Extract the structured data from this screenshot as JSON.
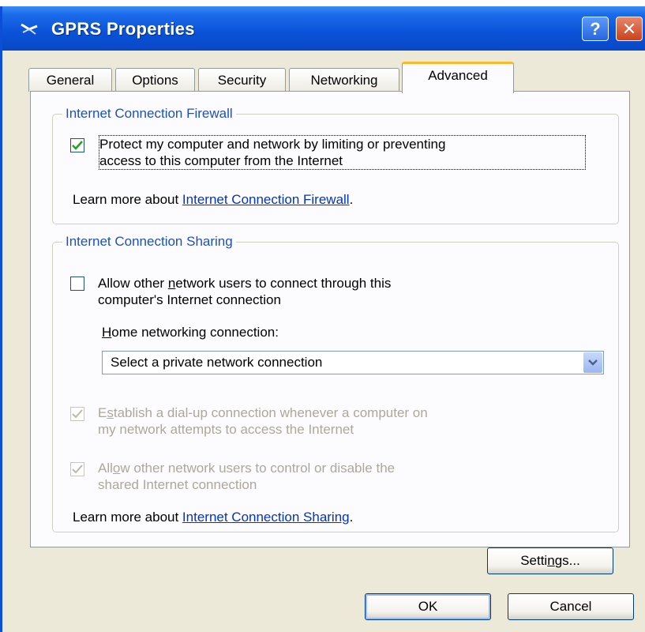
{
  "window": {
    "title": "GPRS Properties",
    "help_glyph": "?",
    "close_glyph": "✕"
  },
  "tabs": [
    {
      "label": "General",
      "active": false
    },
    {
      "label": "Options",
      "active": false
    },
    {
      "label": "Security",
      "active": false
    },
    {
      "label": "Networking",
      "active": false
    },
    {
      "label": "Advanced",
      "active": true
    }
  ],
  "firewall": {
    "group_label": "Internet Connection Firewall",
    "protect_checked": true,
    "protect_label_line1": "Protect my computer and network by limiting or preventing",
    "protect_label_line2": "access to this computer from the Internet",
    "learn_prefix": "Learn more about ",
    "learn_link": "Internet Connection Firewall",
    "learn_suffix": "."
  },
  "sharing": {
    "group_label": "Internet Connection Sharing",
    "allow_checked": false,
    "allow_line1_pre": "Allow other ",
    "allow_line1_accel": "n",
    "allow_line1_post": "etwork users to connect through this",
    "allow_line2": "computer's Internet connection",
    "home_label_accel": "H",
    "home_label_rest": "ome networking connection:",
    "combo_value": "Select a private network connection",
    "establish_checked": true,
    "establish_line1_pre": "E",
    "establish_line1_accel": "s",
    "establish_line1_post": "tablish a dial-up connection whenever a computer on",
    "establish_line2": "my network attempts to access the Internet",
    "control_checked": true,
    "control_line1_pre": "All",
    "control_line1_accel": "o",
    "control_line1_post": "w other network users to control or disable the",
    "control_line2": "shared Internet connection",
    "learn_prefix": "Learn more about ",
    "learn_link": "Internet Connection Sharing",
    "learn_suffix": "."
  },
  "buttons": {
    "settings_pre": "Setti",
    "settings_accel": "n",
    "settings_post": "gs...",
    "ok": "OK",
    "cancel": "Cancel"
  },
  "icons": {
    "title": "network-connection-icon",
    "help": "help-icon",
    "close": "close-icon",
    "check": "checkmark-icon",
    "combo": "chevron-down-icon"
  },
  "colors": {
    "titlebar": "#0a52d8",
    "group_label": "#1e4fbf",
    "link": "#0033cc",
    "active_tab_accent": "#fbb82c",
    "disabled_text": "#aca899"
  }
}
